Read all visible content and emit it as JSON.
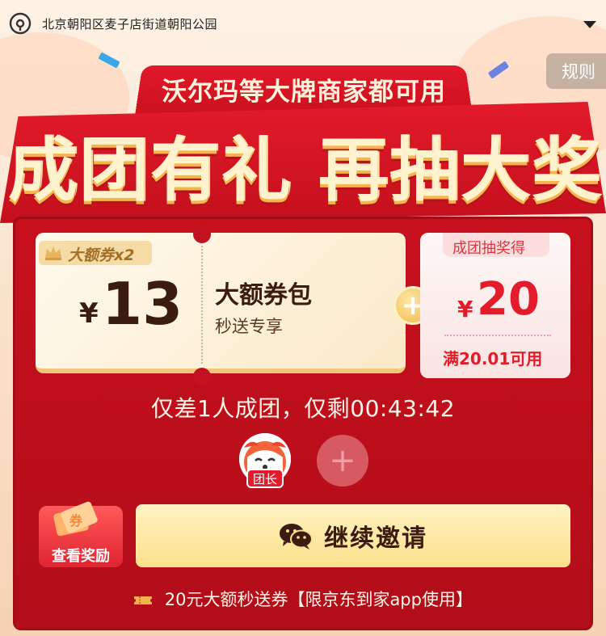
{
  "location": {
    "address": "北京朝阳区麦子店街道朝阳公园",
    "pin_icon": "location-pin-icon",
    "caret_icon": "caret-down-icon"
  },
  "rules_label": "规则",
  "banner": {
    "subtitle": "沃尔玛等大牌商家都可用",
    "headline": "成团有礼 再抽大奖"
  },
  "coupon_pack": {
    "badge": "大额券x2",
    "currency": "¥",
    "amount": "13",
    "title": "大额券包",
    "subtitle": "秒送专享"
  },
  "plus_symbol": "+",
  "prize": {
    "label": "成团抽奖得",
    "currency": "¥",
    "amount": "20",
    "condition": "满20.01可用"
  },
  "countdown_text": "仅差1人成团，仅剩00:43:42",
  "members": {
    "leader_tag": "团长",
    "empty_slot": "+"
  },
  "reward_tile_label": "查看奖励",
  "invite_button": "继续邀请",
  "footer_text": "20元大额秒送券【限京东到家app使用】",
  "colors": {
    "primary_red": "#c8101d",
    "accent_gold": "#fbe08c",
    "text_dark": "#3a1d10"
  }
}
